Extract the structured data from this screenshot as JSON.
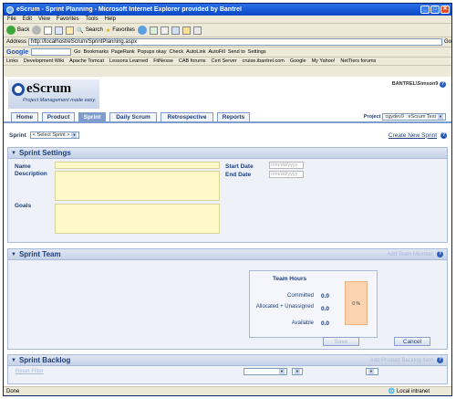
{
  "window": {
    "title": "eScrum - Sprint Planning - Microsoft Internet Explorer provided by Bantrel"
  },
  "menu": [
    "File",
    "Edit",
    "View",
    "Favorites",
    "Tools",
    "Help"
  ],
  "toolbar": {
    "back": "Back",
    "search": "Search",
    "favorites": "Favorites"
  },
  "address": {
    "label": "Address",
    "url": "http://localhost/eScrum/SprintPlanning.aspx",
    "go": "Go"
  },
  "google_toolbar": {
    "logo": "Google",
    "go": "Go",
    "bookmarks": "Bookmarks",
    "pagerank": "PageRank",
    "popups": "Popups okay",
    "check": "Check",
    "autolink": "AutoLink",
    "autofill": "AutoFill",
    "sendto": "Send to",
    "settings": "Settings"
  },
  "links": {
    "label": "Links",
    "items": [
      "Development Wiki",
      "Apache Tomcat",
      "Lessons Learned",
      "FitNesse",
      "CAB forums",
      "Cert Server",
      "cruise.ibantrel.com",
      "Google",
      "My Yahoo!",
      "NetTiers forums"
    ]
  },
  "app": {
    "logo": "eScrum",
    "tagline": "Project Management made easy.",
    "user": "BANTREL\\Simson9",
    "tabs": [
      "Home",
      "Product",
      "Sprint",
      "Daily Scrum",
      "Retrospective",
      "Reports"
    ],
    "project_label": "Project",
    "project_value": "cgydev9 : eScrum Test"
  },
  "sprint": {
    "label": "Sprint",
    "select_value": "< Select Sprint >",
    "create_link": "Create New Sprint"
  },
  "settings": {
    "title": "Sprint Settings",
    "name_label": "Name",
    "description_label": "Description",
    "goals_label": "Goals",
    "start_label": "Start Date",
    "end_label": "End Date",
    "date_placeholder": "mm/dd/yyyy"
  },
  "team": {
    "title": "Sprint Team",
    "add_member": "Add Team Member",
    "hours": {
      "title": "Team Hours",
      "committed_label": "Committed",
      "committed_value": "0.0",
      "allocated_label": "Allocated + Unassigned",
      "allocated_value": "0.0",
      "available_label": "Available",
      "available_value": "0.0",
      "percent": "0 %"
    },
    "save": "Save",
    "cancel": "Cancel"
  },
  "backlog": {
    "title": "Sprint Backlog",
    "add_item": "Add Product Backlog Item",
    "reset_filter": "Reset Filter"
  },
  "status": {
    "text": "Done",
    "zone": "Local intranet"
  }
}
